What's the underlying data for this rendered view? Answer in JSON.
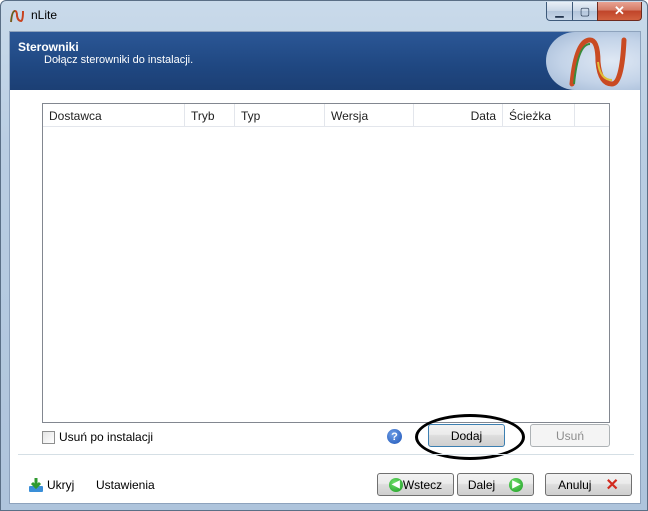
{
  "window": {
    "title": "nLite",
    "minimize_icon": "minimize-icon",
    "maximize_icon": "maximize-icon",
    "close_icon": "close-icon"
  },
  "banner": {
    "title": "Sterowniki",
    "subtitle": "Dołącz sterowniki do instalacji.",
    "logo_icon": "nlite-logo"
  },
  "list": {
    "columns": [
      "Dostawca",
      "Tryb",
      "Typ",
      "Wersja",
      "Data",
      "Ścieżka"
    ],
    "rows": []
  },
  "options": {
    "remove_after_install_label": "Usuń po instalacji",
    "remove_after_install_checked": false
  },
  "buttons": {
    "add": "Dodaj",
    "remove": "Usuń",
    "help_icon": "help-icon"
  },
  "footer": {
    "hide_label": "Ukryj",
    "settings_label": "Ustawienia",
    "back_label": "Wstecz",
    "next_label": "Dalej",
    "cancel_label": "Anuluj"
  },
  "colors": {
    "banner": "#1f4781",
    "highlight_oval": "#000000"
  }
}
